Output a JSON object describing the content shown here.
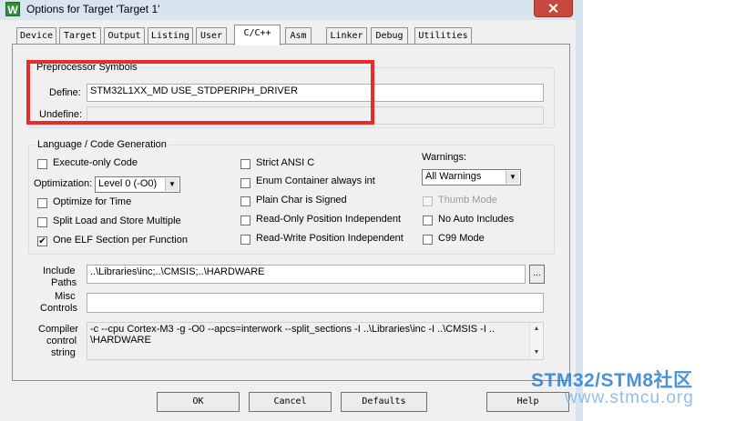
{
  "window": {
    "app_icon_letter": "W",
    "title": "Options for Target 'Target 1'"
  },
  "tabs": [
    "Device",
    "Target",
    "Output",
    "Listing",
    "User",
    "C/C++",
    "Asm",
    "Linker",
    "Debug",
    "Utilities"
  ],
  "active_tab": "C/C++",
  "preprocessor": {
    "legend": "Preprocessor Symbols",
    "define_label": "Define:",
    "define_value": "STM32L1XX_MD USE_STDPERIPH_DRIVER",
    "undefine_label": "Undefine:",
    "undefine_value": ""
  },
  "language": {
    "legend": "Language / Code Generation",
    "execute_only": {
      "label": "Execute-only Code",
      "checked": false
    },
    "optimization_label": "Optimization:",
    "optimization_value": "Level 0 (-O0)",
    "optimize_time": {
      "label": "Optimize for Time",
      "checked": false
    },
    "split_load": {
      "label": "Split Load and Store Multiple",
      "checked": false
    },
    "one_elf": {
      "label": "One ELF Section per Function",
      "checked": true
    },
    "strict_ansi": {
      "label": "Strict ANSI C",
      "checked": false
    },
    "enum_container": {
      "label": "Enum Container always int",
      "checked": false
    },
    "plain_char": {
      "label": "Plain Char is Signed",
      "checked": false
    },
    "ro_pos": {
      "label": "Read-Only Position Independent",
      "checked": false
    },
    "rw_pos": {
      "label": "Read-Write Position Independent",
      "checked": false
    },
    "warnings_label": "Warnings:",
    "warnings_value": "All Warnings",
    "thumb_mode": {
      "label": "Thumb Mode",
      "checked": false,
      "disabled": true
    },
    "no_auto_includes": {
      "label": "No Auto Includes",
      "checked": false
    },
    "c99_mode": {
      "label": "C99 Mode",
      "checked": false
    }
  },
  "include_paths": {
    "label_line1": "Include",
    "label_line2": "Paths",
    "value": "..\\Libraries\\inc;..\\CMSIS;..\\HARDWARE",
    "browse_label": "..."
  },
  "misc_controls": {
    "label_line1": "Misc",
    "label_line2": "Controls",
    "value": ""
  },
  "compiler_control": {
    "label_line1": "Compiler",
    "label_line2": "control",
    "label_line3": "string",
    "line1": "-c --cpu Cortex-M3 -g -O0 --apcs=interwork --split_sections -I ..\\Libraries\\inc -I ..\\CMSIS -I ..",
    "line2": "\\HARDWARE"
  },
  "buttons": {
    "ok": "OK",
    "cancel": "Cancel",
    "defaults": "Defaults",
    "help": "Help"
  },
  "watermark": {
    "title": "STM32/STM8社区",
    "url": "www.stmcu.org"
  },
  "colors": {
    "highlight_box": "#ea2b2b",
    "close_button": "#c7483c",
    "watermark": "#2c7fcf"
  }
}
